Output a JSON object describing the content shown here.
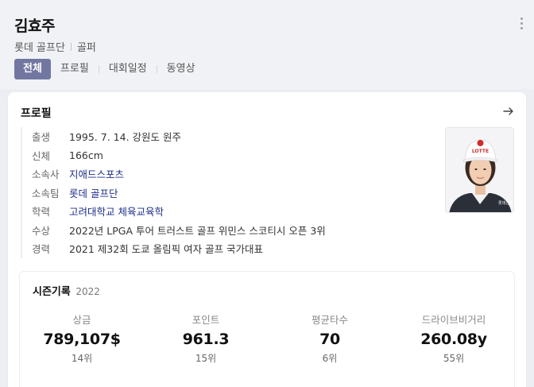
{
  "player": {
    "name": "김효주",
    "team": "롯데 골프단",
    "role": "골퍼"
  },
  "tabs": [
    {
      "label": "전체",
      "active": true
    },
    {
      "label": "프로필",
      "active": false
    },
    {
      "label": "대회일정",
      "active": false
    },
    {
      "label": "동영상",
      "active": false
    }
  ],
  "profile": {
    "title": "프로필",
    "rows": [
      {
        "label": "출생",
        "value": "1995. 7. 14. 강원도 원주",
        "link": false
      },
      {
        "label": "신체",
        "value": "166cm",
        "link": false
      },
      {
        "label": "소속사",
        "value": "지애드스포츠",
        "link": true
      },
      {
        "label": "소속팀",
        "value": "롯데 골프단",
        "link": true
      },
      {
        "label": "학력",
        "value": "고려대학교 체육교육학",
        "link": true
      },
      {
        "label": "수상",
        "value": "2022년 LPGA 투어 트러스트 골프 위민스 스코티시 오픈 3위",
        "link": false
      },
      {
        "label": "경력",
        "value": "2021 제32회 도쿄 올림픽 여자 골프 국가대표",
        "link": false
      }
    ],
    "photo_cap_text": "LOTTE",
    "photo_shirt_text": "롯데건설"
  },
  "season": {
    "title": "시즌기록",
    "year": "2022",
    "stats": [
      {
        "label": "상금",
        "value": "789,107$",
        "rank": "14위"
      },
      {
        "label": "포인트",
        "value": "961.3",
        "rank": "15위"
      },
      {
        "label": "평균타수",
        "value": "70",
        "rank": "6위"
      },
      {
        "label": "드라이브비거리",
        "value": "260.08y",
        "rank": "55위"
      }
    ]
  },
  "icons": {
    "more": "more-vertical-icon",
    "arrow": "arrow-right-icon"
  },
  "colors": {
    "active_tab": "#7277a1",
    "link": "#1d2e8a",
    "header_bg": "#f1f2f6"
  }
}
